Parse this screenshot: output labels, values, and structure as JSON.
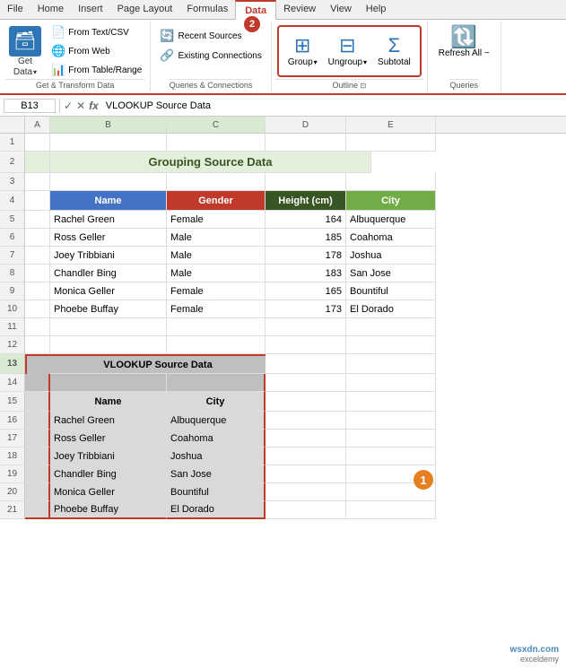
{
  "ribbon": {
    "tabs": [
      "File",
      "Home",
      "Insert",
      "Page Layout",
      "Formulas",
      "Data",
      "Review",
      "View",
      "Help"
    ],
    "active_tab": "Data",
    "groups": {
      "get_transform": {
        "label": "Get & Transform Data",
        "get_data_label": "Get\nData",
        "from_text_csv": "From Text/CSV",
        "from_web": "From Web",
        "from_table": "From Table/Range",
        "recent_sources": "Recent Sources",
        "existing_connections": "Existing Connections"
      },
      "queries": {
        "label": "Queries & Connections",
        "badge": "2"
      },
      "outline": {
        "label": "Outline",
        "group_label": "Group",
        "ungroup_label": "Ungroup",
        "subtotal_label": "Subtotal"
      },
      "refresh": {
        "label": "Refresh All ~"
      }
    }
  },
  "formula_bar": {
    "cell_ref": "B13",
    "formula": "VLOOKUP Source Data"
  },
  "spreadsheet": {
    "col_headers": [
      "A",
      "B",
      "C",
      "D",
      "E"
    ],
    "row_headers": [
      "1",
      "2",
      "3",
      "4",
      "5",
      "6",
      "7",
      "8",
      "9",
      "10",
      "11",
      "12",
      "13",
      "14",
      "15",
      "16",
      "17",
      "18",
      "19",
      "20",
      "21"
    ],
    "title": "Grouping Source Data",
    "headers": [
      "Name",
      "Gender",
      "Height (cm)",
      "City"
    ],
    "data_rows": [
      [
        "Rachel Green",
        "Female",
        "164",
        "Albuquerque"
      ],
      [
        "Ross Geller",
        "Male",
        "185",
        "Coahoma"
      ],
      [
        "Joey Tribbiani",
        "Male",
        "178",
        "Joshua"
      ],
      [
        "Chandler Bing",
        "Male",
        "183",
        "San Jose"
      ],
      [
        "Monica Geller",
        "Female",
        "165",
        "Bountiful"
      ],
      [
        "Phoebe Buffay",
        "Female",
        "173",
        "El Dorado"
      ]
    ],
    "vlookup": {
      "title": "VLOOKUP Source Data",
      "headers": [
        "Name",
        "City"
      ],
      "rows": [
        [
          "Rachel Green",
          "Albuquerque"
        ],
        [
          "Ross Geller",
          "Coahoma"
        ],
        [
          "Joey Tribbiani",
          "Joshua"
        ],
        [
          "Chandler Bing",
          "San Jose"
        ],
        [
          "Monica Geller",
          "Bountiful"
        ],
        [
          "Phoebe Buffay",
          "El Dorado"
        ]
      ]
    }
  },
  "badges": {
    "badge1_label": "1",
    "badge2_label": "2"
  },
  "watermark": {
    "site": "wsxdn.com",
    "sub": "exceldemy"
  }
}
